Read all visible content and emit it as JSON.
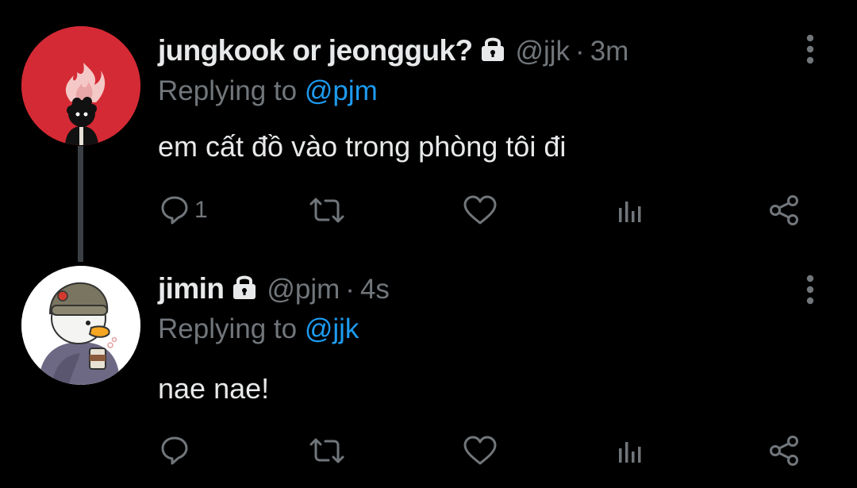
{
  "tweets": [
    {
      "display_name": "jungkook or jeongguk?",
      "handle": "@jjk",
      "separator": "·",
      "time": "3m",
      "replying_prefix": "Replying to ",
      "replying_to": "@pjm",
      "text": "em cất đồ vào trong phòng tôi đi",
      "reply_count": "1",
      "protected": true,
      "avatar": "red-avatar-black-haired-figure-with-flames"
    },
    {
      "display_name": "jimin",
      "handle": "@pjm",
      "separator": "·",
      "time": "4s",
      "replying_prefix": "Replying to ",
      "replying_to": "@jjk",
      "text": "nae nae!",
      "reply_count": "",
      "protected": true,
      "avatar": "duck-in-beanie-holding-coffee"
    }
  ],
  "colors": {
    "background": "#000000",
    "text": "#e7e9ea",
    "secondary": "#71767b",
    "accent": "#1d9bf0",
    "thread_line": "#3a3f44"
  },
  "icons": [
    "lock-icon",
    "more-icon",
    "reply-icon",
    "retweet-icon",
    "like-icon",
    "views-icon",
    "share-icon"
  ]
}
